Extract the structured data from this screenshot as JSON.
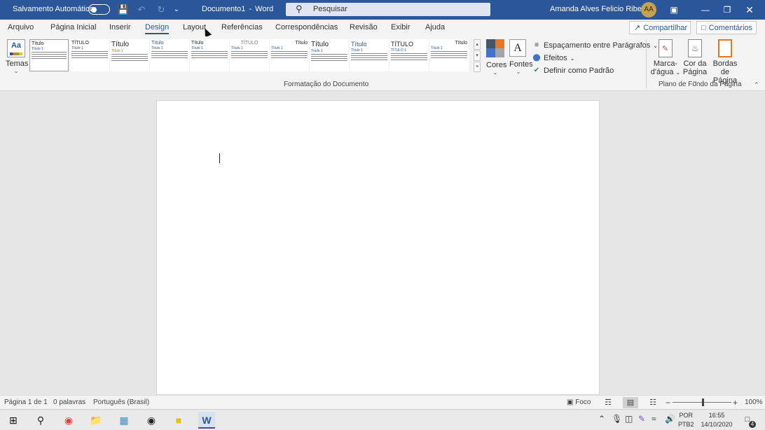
{
  "titlebar": {
    "autosave_label": "Salvamento Automático",
    "doc_title": "Documento1",
    "separator": "-",
    "app_name": "Word",
    "search_placeholder": "Pesquisar",
    "user_name": "Amanda Alves Felicio Ribeiro",
    "user_initials": "AA"
  },
  "tabs": [
    {
      "label": "Arquivo",
      "active": false
    },
    {
      "label": "Página Inicial",
      "active": false
    },
    {
      "label": "Inserir",
      "active": false
    },
    {
      "label": "Design",
      "active": true
    },
    {
      "label": "Layout",
      "active": false
    },
    {
      "label": "Referências",
      "active": false
    },
    {
      "label": "Correspondências",
      "active": false
    },
    {
      "label": "Revisão",
      "active": false
    },
    {
      "label": "Exibir",
      "active": false
    },
    {
      "label": "Ajuda",
      "active": false
    }
  ],
  "share_label": "Compartilhar",
  "comments_label": "Comentários",
  "ribbon": {
    "temas_label": "Temas",
    "temas_icon_text": "Aa",
    "gallery": [
      {
        "title": "Título",
        "subtitle": "Título 1"
      },
      {
        "title": "TÍTULO",
        "subtitle": "Título 1"
      },
      {
        "title": "Título",
        "subtitle": "Título 1"
      },
      {
        "title": "Título",
        "subtitle": "Título 1"
      },
      {
        "title": "Título",
        "subtitle": "Título 1"
      },
      {
        "title": "TÍTULO",
        "subtitle": "Título 1"
      },
      {
        "title": "Título",
        "subtitle": "Título 1"
      },
      {
        "title": "Título",
        "subtitle": "Título 1"
      },
      {
        "title": "Título",
        "subtitle": "Título 1"
      },
      {
        "title": "TÍTULO",
        "subtitle": "TÍTULO 1"
      },
      {
        "title": "Título",
        "subtitle": "Título 1"
      }
    ],
    "cores_label": "Cores",
    "fontes_label": "Fontes",
    "fontes_icon_text": "A",
    "espacamento_label": "Espaçamento entre Parágrafos",
    "efeitos_label": "Efeitos",
    "definir_label": "Definir como Padrão",
    "group_formatacao": "Formatação do Documento",
    "marca_dagua_line1": "Marca-",
    "marca_dagua_line2": "d'água",
    "cor_pagina_line1": "Cor da",
    "cor_pagina_line2": "Página",
    "bordas_line1": "Bordas",
    "bordas_line2": "de Página",
    "group_plano": "Plano de Fundo da Página"
  },
  "statusbar": {
    "page_info": "Página 1 de 1",
    "word_count": "0 palavras",
    "language": "Português (Brasil)",
    "focus_label": "Foco",
    "zoom_minus": "−",
    "zoom_plus": "+",
    "zoom": "100%"
  },
  "taskbar": {
    "lang_line1": "POR",
    "lang_line2": "PTB2",
    "time": "16:55",
    "date": "14/10/2020",
    "notification_count": "4"
  },
  "colors": {
    "brand": "#2b579a",
    "cores_swatch": [
      "#44546a",
      "#e87722",
      "#4472c4",
      "#a5a5a5"
    ]
  }
}
